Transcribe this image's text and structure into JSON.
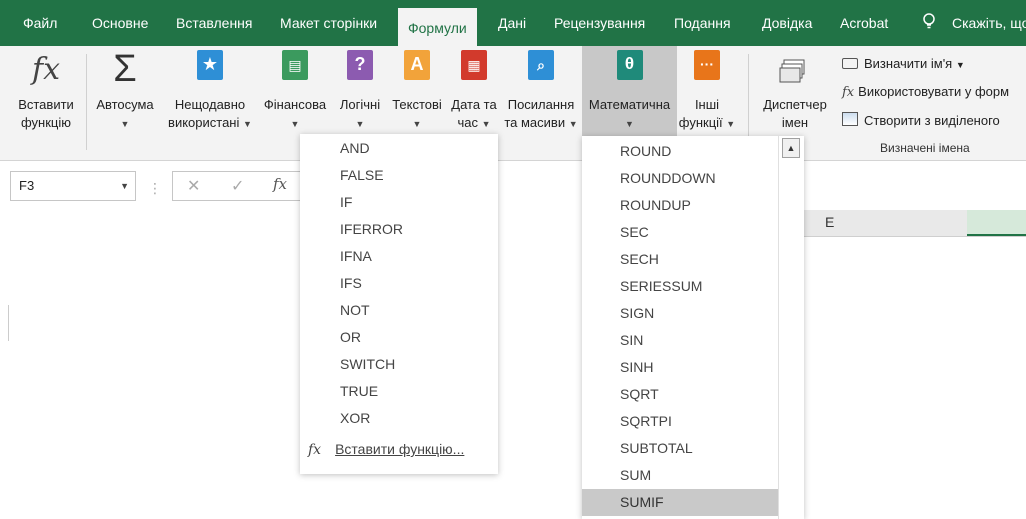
{
  "menu": {
    "items": [
      "Файл",
      "Основне",
      "Вставлення",
      "Макет сторінки",
      "Формули",
      "Дані",
      "Рецензування",
      "Подання",
      "Довідка",
      "Acrobat"
    ],
    "active": "Формули",
    "tell_me": "Скажіть, що"
  },
  "ribbon": {
    "insert_function": {
      "line1": "Вставити",
      "line2": "функцію",
      "icon": "fx-icon"
    },
    "autosum": {
      "line1": "Автосума",
      "icon": "sigma-icon"
    },
    "recent": {
      "line1": "Нещодавно",
      "line2": "використані",
      "icon": "star-book-icon"
    },
    "financial": {
      "line1": "Фінансова",
      "icon": "financial-book-icon"
    },
    "logical": {
      "line1": "Логічні",
      "icon": "question-book-icon"
    },
    "text": {
      "line1": "Текстові",
      "icon": "text-book-icon"
    },
    "datetime": {
      "line1": "Дата та",
      "line2": "час",
      "icon": "calendar-book-icon"
    },
    "lookup": {
      "line1": "Посилання",
      "line2": "та масиви",
      "icon": "lookup-book-icon"
    },
    "math": {
      "line1": "Математична",
      "icon": "theta-book-icon"
    },
    "more": {
      "line1": "Інші",
      "line2": "функції",
      "icon": "more-book-icon"
    },
    "name_manager": {
      "line1": "Диспетчер",
      "line2": "імен",
      "icon": "name-manager-icon"
    },
    "define_name": "Визначити ім'я",
    "use_in_formula": "Використовувати у форм",
    "create_from_selection": "Створити з виділеного",
    "group_label": "Визначені імена"
  },
  "colors": {
    "brand": "#217346",
    "logical": "#8c5bb0",
    "text": "#f2a33a",
    "datetime": "#d23a2c",
    "lookup": "#2e8fd6",
    "math": "#1f8a7a",
    "more": "#e8751a",
    "financial": "#3b9a5e",
    "recent": "#2e8fd6"
  },
  "formula_bar": {
    "name_box": "F3",
    "cancel": "✕",
    "enter": "✓",
    "fx": "fx"
  },
  "grid": {
    "column_e": "E"
  },
  "logical_menu": {
    "items": [
      "AND",
      "FALSE",
      "IF",
      "IFERROR",
      "IFNA",
      "IFS",
      "NOT",
      "OR",
      "SWITCH",
      "TRUE",
      "XOR"
    ],
    "insert_function": "Вставити функцію..."
  },
  "math_menu": {
    "items": [
      "ROUND",
      "ROUNDDOWN",
      "ROUNDUP",
      "SEC",
      "SECH",
      "SERIESSUM",
      "SIGN",
      "SIN",
      "SINH",
      "SQRT",
      "SQRTPI",
      "SUBTOTAL",
      "SUM",
      "SUMIF"
    ],
    "highlighted": "SUMIF"
  }
}
